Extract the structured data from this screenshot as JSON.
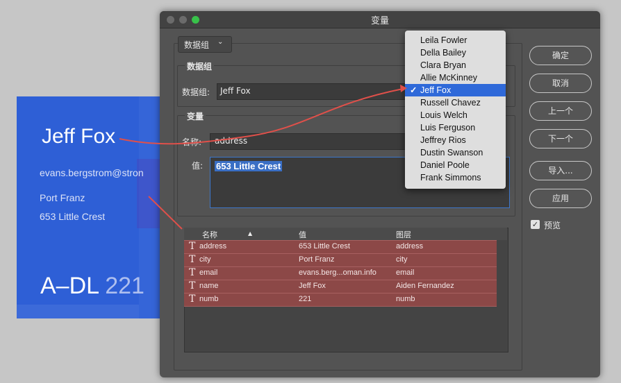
{
  "card": {
    "name": "Jeff Fox",
    "email": "evans.bergstrom@stron",
    "city": "Port Franz",
    "street": "653 Little Crest",
    "code_prefix": "A–DL ",
    "code_number": "221"
  },
  "dialog": {
    "title": "变量",
    "tab_select": "数据组",
    "dataset_group_label": "数据组",
    "dataset_label": "数据组:",
    "dataset_value": "Jeff Fox",
    "var_group_label": "变量",
    "name_label": "名称:",
    "name_value": "address",
    "value_label": "值:",
    "value_value": "653 Little Crest",
    "table": {
      "headers": [
        "名称",
        "值",
        "图层"
      ],
      "rows": [
        {
          "name": "address",
          "value": "653 Little Crest",
          "layer": "address"
        },
        {
          "name": "city",
          "value": "Port Franz",
          "layer": "city"
        },
        {
          "name": "email",
          "value": "evans.berg...oman.info",
          "layer": "email"
        },
        {
          "name": "name",
          "value": "Jeff Fox",
          "layer": "Aiden Fernandez"
        },
        {
          "name": "numb",
          "value": "221",
          "layer": "numb"
        }
      ]
    },
    "buttons": {
      "ok": "确定",
      "cancel": "取消",
      "prev": "上一个",
      "next": "下一个",
      "import": "导入...",
      "apply": "应用"
    },
    "preview_label": "预览",
    "preview_checked": true
  },
  "dropdown": {
    "items": [
      "Leila Fowler",
      "Della Bailey",
      "Clara Bryan",
      "Allie McKinney",
      "Jeff Fox",
      "Russell Chavez",
      "Louis Welch",
      "Luis Ferguson",
      "Jeffrey Rios",
      "Dustin Swanson",
      "Daniel Poole",
      "Frank Simmons"
    ],
    "selected": "Jeff Fox"
  },
  "colors": {
    "annotation_line": "#e0504a",
    "selection": "#2f69d9",
    "row_highlight": "#8c4847",
    "card_blue": "#2e5fd6"
  }
}
